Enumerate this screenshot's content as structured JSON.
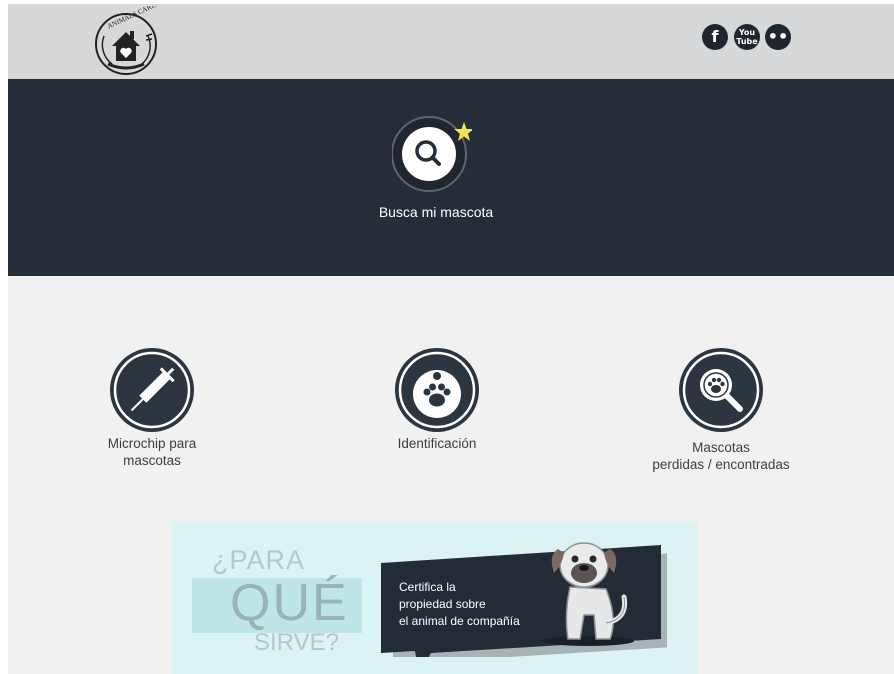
{
  "header": {
    "logo_text": "ANIMALS CARES",
    "social": [
      {
        "icon": "facebook-icon",
        "glyph": "f"
      },
      {
        "icon": "youtube-icon",
        "glyph": "You Tube"
      },
      {
        "icon": "flickr-icon",
        "glyph": "••"
      }
    ]
  },
  "hero": {
    "label": "Busca mi mascota",
    "icon": "search-star-icon"
  },
  "features": [
    {
      "label_line1": "Microchip para",
      "label_line2": "mascotas",
      "icon": "syringe-icon"
    },
    {
      "label_line1": "Identificación",
      "label_line2": "",
      "icon": "paw-tag-icon"
    },
    {
      "label_line1": "Mascotas",
      "label_line2": "perdidas / encontradas",
      "icon": "paw-search-icon"
    }
  ],
  "banner": {
    "para": "¿PARA",
    "que": "QUÉ",
    "sirve": "SIRVE?",
    "bubble_lines": [
      "Certifica la",
      "propiedad sobre",
      "el animal de compañía"
    ]
  },
  "colors": {
    "header_bg": "#d6d8da",
    "hero_bg": "#252d38",
    "page_bg": "#f1f1f1",
    "icon_dark": "#2c3640",
    "star": "#f5e64b",
    "banner_bg": "#dcf3f3"
  }
}
